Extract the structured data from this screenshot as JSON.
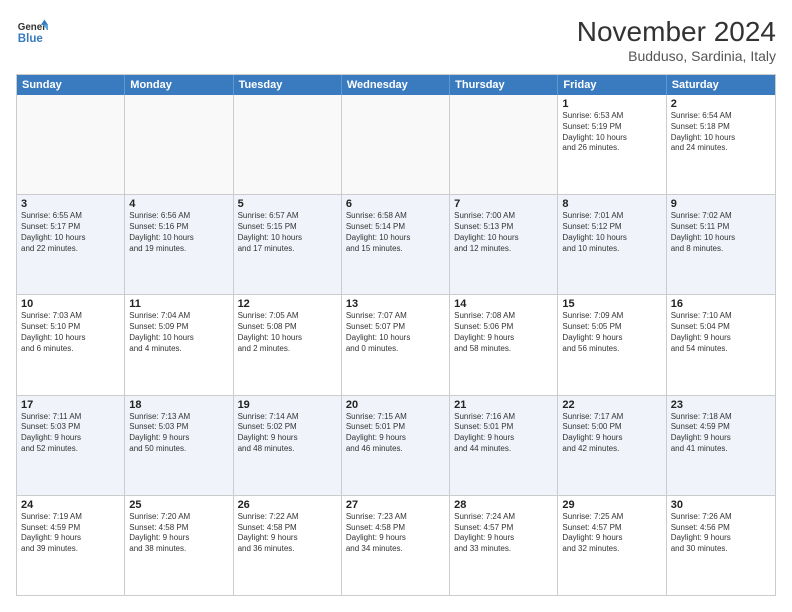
{
  "header": {
    "logo_line1": "General",
    "logo_line2": "Blue",
    "month": "November 2024",
    "location": "Budduso, Sardinia, Italy"
  },
  "days_of_week": [
    "Sunday",
    "Monday",
    "Tuesday",
    "Wednesday",
    "Thursday",
    "Friday",
    "Saturday"
  ],
  "rows": [
    [
      {
        "day": "",
        "info": ""
      },
      {
        "day": "",
        "info": ""
      },
      {
        "day": "",
        "info": ""
      },
      {
        "day": "",
        "info": ""
      },
      {
        "day": "",
        "info": ""
      },
      {
        "day": "1",
        "info": "Sunrise: 6:53 AM\nSunset: 5:19 PM\nDaylight: 10 hours\nand 26 minutes."
      },
      {
        "day": "2",
        "info": "Sunrise: 6:54 AM\nSunset: 5:18 PM\nDaylight: 10 hours\nand 24 minutes."
      }
    ],
    [
      {
        "day": "3",
        "info": "Sunrise: 6:55 AM\nSunset: 5:17 PM\nDaylight: 10 hours\nand 22 minutes."
      },
      {
        "day": "4",
        "info": "Sunrise: 6:56 AM\nSunset: 5:16 PM\nDaylight: 10 hours\nand 19 minutes."
      },
      {
        "day": "5",
        "info": "Sunrise: 6:57 AM\nSunset: 5:15 PM\nDaylight: 10 hours\nand 17 minutes."
      },
      {
        "day": "6",
        "info": "Sunrise: 6:58 AM\nSunset: 5:14 PM\nDaylight: 10 hours\nand 15 minutes."
      },
      {
        "day": "7",
        "info": "Sunrise: 7:00 AM\nSunset: 5:13 PM\nDaylight: 10 hours\nand 12 minutes."
      },
      {
        "day": "8",
        "info": "Sunrise: 7:01 AM\nSunset: 5:12 PM\nDaylight: 10 hours\nand 10 minutes."
      },
      {
        "day": "9",
        "info": "Sunrise: 7:02 AM\nSunset: 5:11 PM\nDaylight: 10 hours\nand 8 minutes."
      }
    ],
    [
      {
        "day": "10",
        "info": "Sunrise: 7:03 AM\nSunset: 5:10 PM\nDaylight: 10 hours\nand 6 minutes."
      },
      {
        "day": "11",
        "info": "Sunrise: 7:04 AM\nSunset: 5:09 PM\nDaylight: 10 hours\nand 4 minutes."
      },
      {
        "day": "12",
        "info": "Sunrise: 7:05 AM\nSunset: 5:08 PM\nDaylight: 10 hours\nand 2 minutes."
      },
      {
        "day": "13",
        "info": "Sunrise: 7:07 AM\nSunset: 5:07 PM\nDaylight: 10 hours\nand 0 minutes."
      },
      {
        "day": "14",
        "info": "Sunrise: 7:08 AM\nSunset: 5:06 PM\nDaylight: 9 hours\nand 58 minutes."
      },
      {
        "day": "15",
        "info": "Sunrise: 7:09 AM\nSunset: 5:05 PM\nDaylight: 9 hours\nand 56 minutes."
      },
      {
        "day": "16",
        "info": "Sunrise: 7:10 AM\nSunset: 5:04 PM\nDaylight: 9 hours\nand 54 minutes."
      }
    ],
    [
      {
        "day": "17",
        "info": "Sunrise: 7:11 AM\nSunset: 5:03 PM\nDaylight: 9 hours\nand 52 minutes."
      },
      {
        "day": "18",
        "info": "Sunrise: 7:13 AM\nSunset: 5:03 PM\nDaylight: 9 hours\nand 50 minutes."
      },
      {
        "day": "19",
        "info": "Sunrise: 7:14 AM\nSunset: 5:02 PM\nDaylight: 9 hours\nand 48 minutes."
      },
      {
        "day": "20",
        "info": "Sunrise: 7:15 AM\nSunset: 5:01 PM\nDaylight: 9 hours\nand 46 minutes."
      },
      {
        "day": "21",
        "info": "Sunrise: 7:16 AM\nSunset: 5:01 PM\nDaylight: 9 hours\nand 44 minutes."
      },
      {
        "day": "22",
        "info": "Sunrise: 7:17 AM\nSunset: 5:00 PM\nDaylight: 9 hours\nand 42 minutes."
      },
      {
        "day": "23",
        "info": "Sunrise: 7:18 AM\nSunset: 4:59 PM\nDaylight: 9 hours\nand 41 minutes."
      }
    ],
    [
      {
        "day": "24",
        "info": "Sunrise: 7:19 AM\nSunset: 4:59 PM\nDaylight: 9 hours\nand 39 minutes."
      },
      {
        "day": "25",
        "info": "Sunrise: 7:20 AM\nSunset: 4:58 PM\nDaylight: 9 hours\nand 38 minutes."
      },
      {
        "day": "26",
        "info": "Sunrise: 7:22 AM\nSunset: 4:58 PM\nDaylight: 9 hours\nand 36 minutes."
      },
      {
        "day": "27",
        "info": "Sunrise: 7:23 AM\nSunset: 4:58 PM\nDaylight: 9 hours\nand 34 minutes."
      },
      {
        "day": "28",
        "info": "Sunrise: 7:24 AM\nSunset: 4:57 PM\nDaylight: 9 hours\nand 33 minutes."
      },
      {
        "day": "29",
        "info": "Sunrise: 7:25 AM\nSunset: 4:57 PM\nDaylight: 9 hours\nand 32 minutes."
      },
      {
        "day": "30",
        "info": "Sunrise: 7:26 AM\nSunset: 4:56 PM\nDaylight: 9 hours\nand 30 minutes."
      }
    ]
  ]
}
